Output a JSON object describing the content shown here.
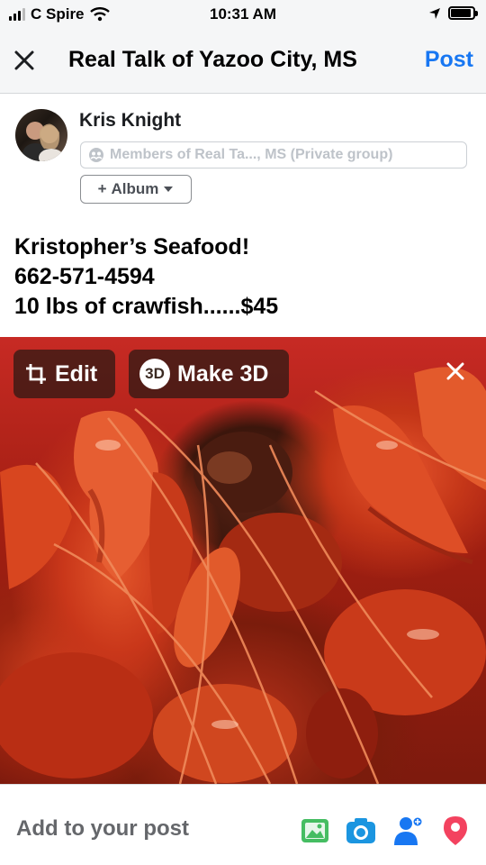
{
  "status_bar": {
    "carrier": "C Spire",
    "time": "10:31 AM",
    "battery_level": 0.9
  },
  "header": {
    "title": "Real Talk of Yazoo City, MS",
    "post_label": "Post"
  },
  "author": {
    "name": "Kris Knight",
    "audience": "Members of Real Ta..., MS (Private group)",
    "album_label": "Album"
  },
  "post": {
    "lines": [
      "Kristopher’s Seafood!",
      "662-571-4594",
      "10 lbs of crawfish......$45"
    ]
  },
  "photo": {
    "edit_label": "Edit",
    "make3d_badge": "3D",
    "make3d_label": "Make 3D"
  },
  "bottom_bar": {
    "add_label": "Add to your post",
    "tools": [
      "photo-icon",
      "camera-icon",
      "tag-people-icon",
      "location-pin-icon"
    ]
  },
  "colors": {
    "accent": "#1877f2",
    "photo_tool": "#45bd62",
    "camera_tool": "#1b95e0",
    "tag_tool": "#1877f2",
    "location_tool": "#f3425f"
  }
}
